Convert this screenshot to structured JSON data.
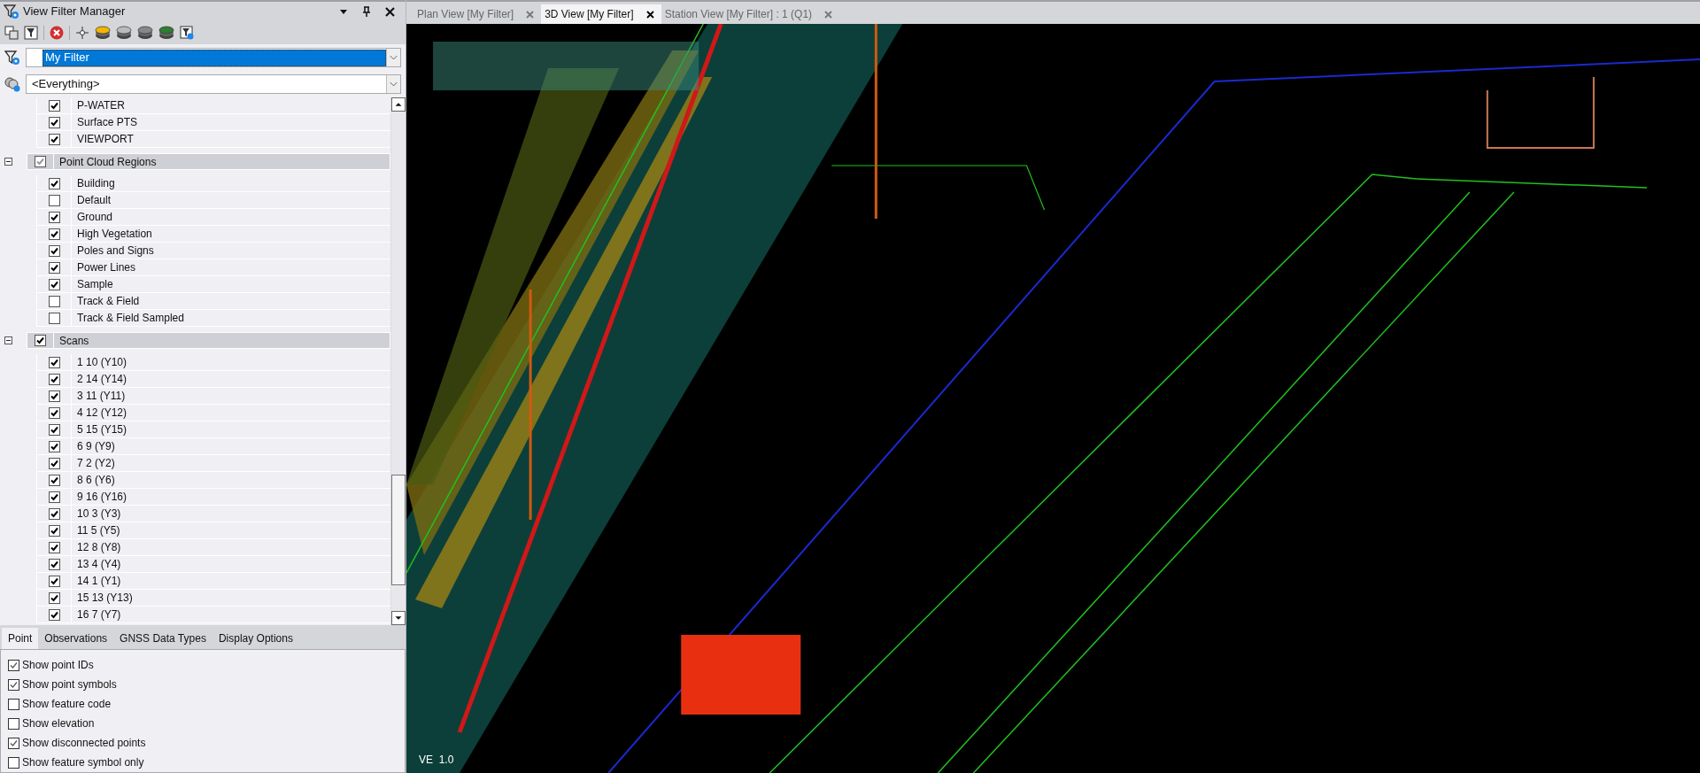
{
  "panel": {
    "title": "View Filter Manager"
  },
  "filter_select": {
    "value": "My Filter"
  },
  "scope_select": {
    "value": "<Everything>"
  },
  "tree": [
    {
      "kind": "items",
      "children": [
        {
          "label": "P-WATER",
          "checked": true
        },
        {
          "label": "Surface PTS",
          "checked": true
        },
        {
          "label": "VIEWPORT",
          "checked": true
        }
      ]
    },
    {
      "kind": "group",
      "label": "Point Cloud Regions",
      "checked": true,
      "partial": true,
      "expanded": true,
      "children": [
        {
          "label": "Building",
          "checked": true
        },
        {
          "label": "Default",
          "checked": false
        },
        {
          "label": "Ground",
          "checked": true
        },
        {
          "label": "High Vegetation",
          "checked": true
        },
        {
          "label": "Poles and Signs",
          "checked": true
        },
        {
          "label": "Power Lines",
          "checked": true
        },
        {
          "label": "Sample",
          "checked": true
        },
        {
          "label": "Track & Field",
          "checked": false
        },
        {
          "label": "Track & Field Sampled",
          "checked": false
        }
      ]
    },
    {
      "kind": "group",
      "label": "Scans",
      "checked": true,
      "partial": false,
      "expanded": true,
      "children": [
        {
          "label": "1 10 (Y10)",
          "checked": true
        },
        {
          "label": "2 14 (Y14)",
          "checked": true
        },
        {
          "label": "3 11 (Y11)",
          "checked": true
        },
        {
          "label": "4 12 (Y12)",
          "checked": true
        },
        {
          "label": "5 15 (Y15)",
          "checked": true
        },
        {
          "label": "6 9 (Y9)",
          "checked": true
        },
        {
          "label": "7 2 (Y2)",
          "checked": true
        },
        {
          "label": "8 6 (Y6)",
          "checked": true
        },
        {
          "label": "9 16 (Y16)",
          "checked": true
        },
        {
          "label": "10 3 (Y3)",
          "checked": true
        },
        {
          "label": "11 5 (Y5)",
          "checked": true
        },
        {
          "label": "12 8 (Y8)",
          "checked": true
        },
        {
          "label": "13 4 (Y4)",
          "checked": true
        },
        {
          "label": "14 1 (Y1)",
          "checked": true
        },
        {
          "label": "15 13 (Y13)",
          "checked": true
        },
        {
          "label": "16 7 (Y7)",
          "checked": true
        }
      ]
    }
  ],
  "option_tabs": [
    {
      "label": "Point",
      "selected": true
    },
    {
      "label": "Observations",
      "selected": false
    },
    {
      "label": "GNSS Data Types",
      "selected": false
    },
    {
      "label": "Display Options",
      "selected": false
    }
  ],
  "options": [
    {
      "label": "Show point IDs",
      "checked": true
    },
    {
      "label": "Show point symbols",
      "checked": true
    },
    {
      "label": "Show feature code",
      "checked": false
    },
    {
      "label": "Show elevation",
      "checked": false
    },
    {
      "label": "Show disconnected points",
      "checked": true
    },
    {
      "label": "Show feature symbol only",
      "checked": false
    }
  ],
  "view_tabs": [
    {
      "label": "Plan View [My Filter]",
      "selected": false
    },
    {
      "label": "3D View [My Filter]",
      "selected": true
    },
    {
      "label": "Station View [My Filter] : 1 (Q1)",
      "selected": false
    }
  ],
  "view": {
    "exaggeration": "VE  1.0"
  }
}
